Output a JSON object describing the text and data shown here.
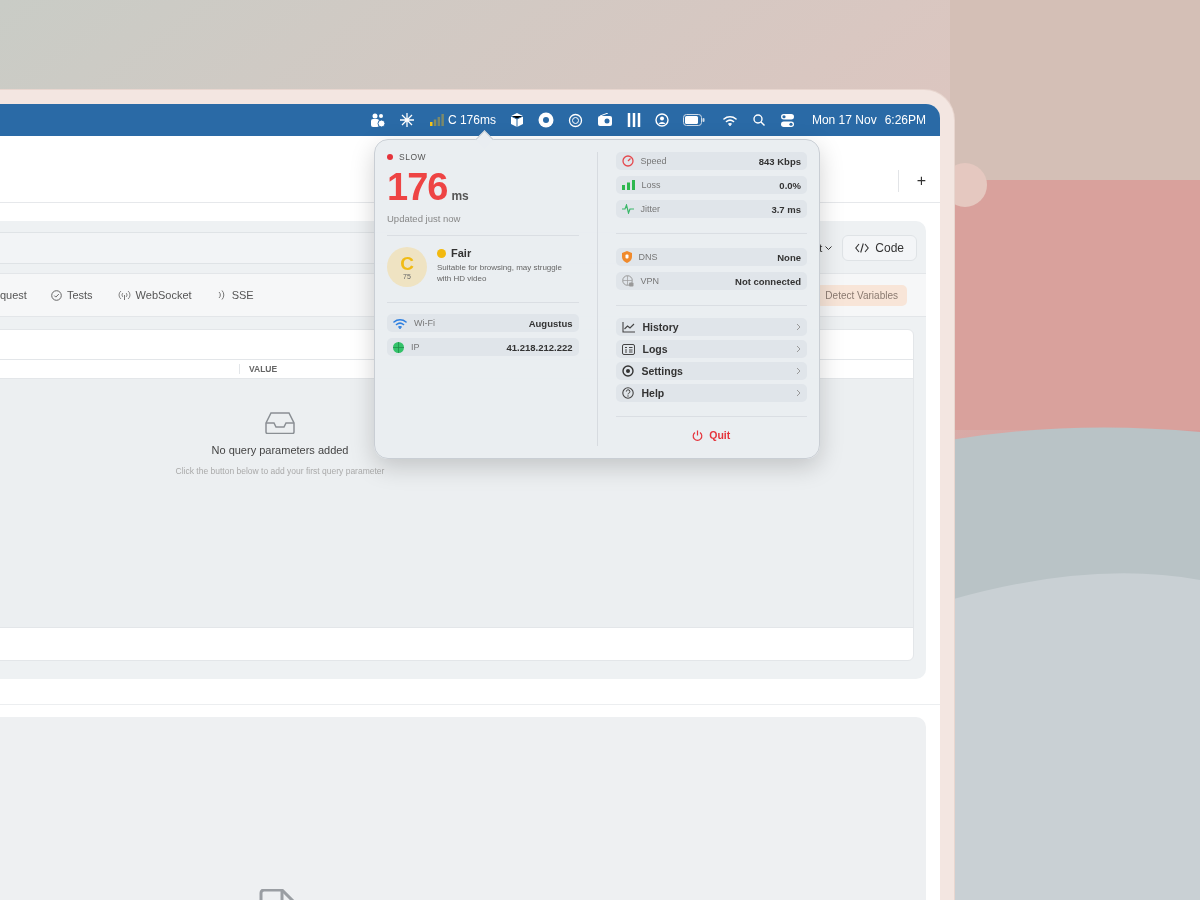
{
  "menu_bar": {
    "status_text": "C 176ms",
    "clock_date": "Mon 17 Nov",
    "clock_time": "6:26PM"
  },
  "app": {
    "new_tab": "+",
    "dropdown_text": "t",
    "code_button": "Code",
    "tabs": [
      {
        "kind": "request",
        "label": "quest"
      },
      {
        "kind": "tests",
        "label": "Tests"
      },
      {
        "kind": "websocket",
        "label": "WebSocket"
      },
      {
        "kind": "sse",
        "label": "SSE"
      }
    ],
    "detect_button": "Detect Variables",
    "table": {
      "columns": [
        "VALUE"
      ]
    },
    "empty_state": {
      "title": "No query parameters added",
      "hint": "Click the button below to add your first query parameter"
    }
  },
  "popover": {
    "status": "SLOW",
    "latency": "176",
    "unit": "ms",
    "updated": "Updated just now",
    "grade": {
      "letter": "C",
      "score": "75",
      "label": "Fair",
      "description": "Suitable for browsing, may struggle with HD video"
    },
    "connection": [
      {
        "kind": "wifi",
        "label": "Wi-Fi",
        "value": "Augustus"
      },
      {
        "kind": "ip",
        "label": "IP",
        "value": "41.218.212.222"
      }
    ],
    "metrics": [
      {
        "kind": "speed",
        "label": "Speed",
        "value": "843 Kbps"
      },
      {
        "kind": "loss",
        "label": "Loss",
        "value": "0.0%"
      },
      {
        "kind": "jitter",
        "label": "Jitter",
        "value": "3.7 ms"
      }
    ],
    "network": [
      {
        "kind": "dns",
        "label": "DNS",
        "value": "None"
      },
      {
        "kind": "vpn",
        "label": "VPN",
        "value": "Not connected"
      }
    ],
    "menu": [
      {
        "kind": "history",
        "label": "History"
      },
      {
        "kind": "logs",
        "label": "Logs"
      },
      {
        "kind": "settings",
        "label": "Settings"
      },
      {
        "kind": "help",
        "label": "Help"
      }
    ],
    "quit": "Quit"
  }
}
